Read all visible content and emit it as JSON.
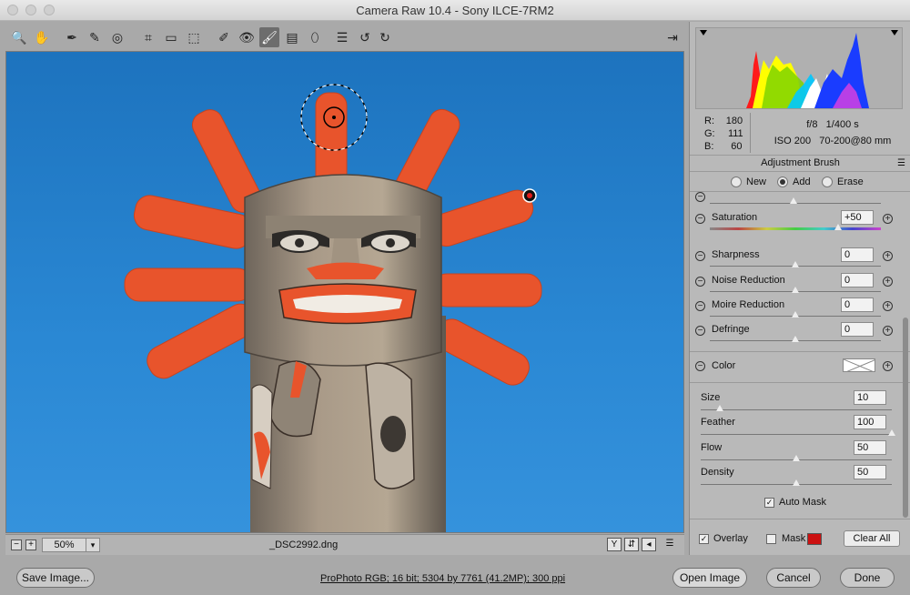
{
  "window": {
    "title": "Camera Raw 10.4  -  Sony ILCE-7RM2"
  },
  "toolbar": {
    "tools": [
      {
        "name": "zoom-tool",
        "icon": "magnifier-icon",
        "glyph": "🔍"
      },
      {
        "name": "hand-tool",
        "icon": "hand-icon",
        "glyph": "✋"
      },
      {
        "name": "white-balance-tool",
        "icon": "eyedropper-icon",
        "glyph": "✒"
      },
      {
        "name": "color-sampler-tool",
        "icon": "color-sampler-icon",
        "glyph": "✎"
      },
      {
        "name": "targeted-adjustment-tool",
        "icon": "target-icon",
        "glyph": "◎"
      },
      {
        "name": "crop-tool",
        "icon": "crop-icon",
        "glyph": "⌗"
      },
      {
        "name": "straighten-tool",
        "icon": "level-icon",
        "glyph": "▭"
      },
      {
        "name": "transform-tool",
        "icon": "transform-icon",
        "glyph": "⬚"
      },
      {
        "name": "spot-removal-tool",
        "icon": "brush-heal-icon",
        "glyph": "✐"
      },
      {
        "name": "red-eye-tool",
        "icon": "eye-icon",
        "glyph": "👁"
      },
      {
        "name": "adjustment-brush-tool",
        "icon": "brush-icon",
        "glyph": "🖌"
      },
      {
        "name": "graduated-filter-tool",
        "icon": "gradient-icon",
        "glyph": "▤"
      },
      {
        "name": "radial-filter-tool",
        "icon": "ellipse-icon",
        "glyph": "⬯"
      },
      {
        "name": "preferences-tool",
        "icon": "list-icon",
        "glyph": "☰"
      },
      {
        "name": "rotate-left-tool",
        "icon": "rotate-left-icon",
        "glyph": "↺"
      },
      {
        "name": "rotate-right-tool",
        "icon": "rotate-right-icon",
        "glyph": "↻"
      }
    ],
    "open_in_photoshop_glyph": "⇥"
  },
  "status": {
    "zoom": "50%",
    "filename": "_DSC2992.dng",
    "view_buttons": [
      "Y",
      "⇵",
      "◂",
      "☰"
    ]
  },
  "camera_info": {
    "r_label": "R:",
    "r": "180",
    "g_label": "G:",
    "g": "111",
    "b_label": "B:",
    "b": "60",
    "aperture": "f/8",
    "shutter": "1/400 s",
    "iso": "ISO 200",
    "lens": "70-200@80 mm"
  },
  "panel": {
    "title": "Adjustment Brush",
    "modes": [
      {
        "label": "New",
        "selected": false
      },
      {
        "label": "Add",
        "selected": true
      },
      {
        "label": "Erase",
        "selected": false
      }
    ],
    "sliders": [
      {
        "label": "Saturation",
        "value": "+50",
        "pos": 0.75
      },
      {
        "label": "Sharpness",
        "value": "0",
        "pos": 0.5
      },
      {
        "label": "Noise Reduction",
        "value": "0",
        "pos": 0.5
      },
      {
        "label": "Moire Reduction",
        "value": "0",
        "pos": 0.5
      },
      {
        "label": "Defringe",
        "value": "0",
        "pos": 0.5
      }
    ],
    "color_label": "Color",
    "brush": [
      {
        "label": "Size",
        "value": "10",
        "pos": 0.1
      },
      {
        "label": "Feather",
        "value": "100",
        "pos": 1.0
      },
      {
        "label": "Flow",
        "value": "50",
        "pos": 0.5
      },
      {
        "label": "Density",
        "value": "50",
        "pos": 0.5
      }
    ],
    "auto_mask_label": "Auto Mask",
    "overlay_label": "Overlay",
    "mask_label": "Mask",
    "mask_color": "#cc1111",
    "clear_all_label": "Clear All"
  },
  "footer": {
    "save_label": "Save Image...",
    "info": "ProPhoto RGB; 16 bit; 5304 by 7761 (41.2MP); 300 ppi",
    "open_label": "Open Image",
    "cancel_label": "Cancel",
    "done_label": "Done"
  },
  "colors": {
    "sky": "#1f78c4",
    "paint": "#e8542c",
    "wood": "#9e8f7e"
  }
}
